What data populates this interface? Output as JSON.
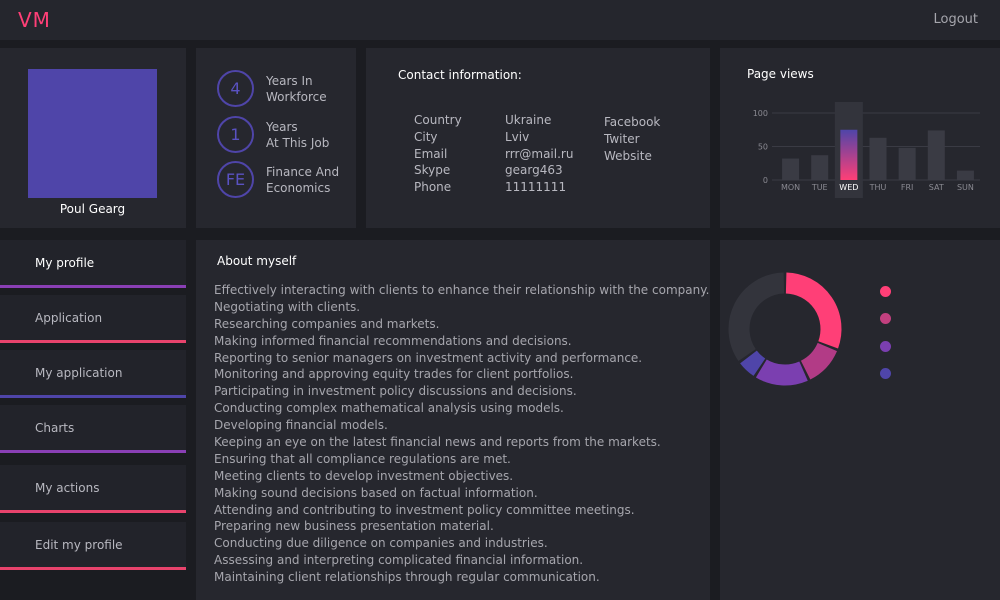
{
  "app": {
    "logo": "VM",
    "logout_label": "Logout"
  },
  "profile": {
    "name": "Poul Gearg"
  },
  "stats": [
    {
      "value": "4",
      "label_line1": "Years In",
      "label_line2": "Workforce"
    },
    {
      "value": "1",
      "label_line1": "Years",
      "label_line2": "At This Job"
    },
    {
      "value": "FE",
      "label_line1": "Finance And",
      "label_line2": "Economics"
    }
  ],
  "contact": {
    "title": "Contact information:",
    "rows": [
      {
        "key": "Country",
        "value": "Ukraine"
      },
      {
        "key": "City",
        "value": "Lviv"
      },
      {
        "key": "Email",
        "value": "rrr@mail.ru"
      },
      {
        "key": "Skype",
        "value": "gearg463"
      },
      {
        "key": "Phone",
        "value": "11111111"
      }
    ],
    "social": [
      "Facebook",
      "Twiter",
      "Website"
    ]
  },
  "page_views": {
    "title": "Page views",
    "y_ticks": [
      "100",
      "50",
      "0"
    ]
  },
  "chart_data": [
    {
      "type": "bar",
      "title": "Page views",
      "categories": [
        "MON",
        "TUE",
        "WED",
        "THU",
        "FRI",
        "SAT",
        "SUN"
      ],
      "values": [
        32,
        37,
        75,
        63,
        48,
        74,
        14
      ],
      "highlighted": "WED",
      "ylim": [
        0,
        100
      ],
      "y_ticks": [
        0,
        50,
        100
      ],
      "grid": true
    },
    {
      "type": "pie",
      "style": "donut",
      "values": [
        31,
        12,
        16,
        6,
        35
      ],
      "colors": [
        "#ff3f77",
        "#b23b86",
        "#7b3fb0",
        "#4f45a9",
        "#33343c"
      ]
    }
  ],
  "menu": {
    "items": [
      {
        "label": "My profile",
        "color": "#8a3fb5"
      },
      {
        "label": "Application",
        "color": "#e8436c"
      },
      {
        "label": "My application",
        "color": "#4f45a9"
      },
      {
        "label": "Charts",
        "color": "#8a3fb5"
      },
      {
        "label": "My actions",
        "color": "#e8436c"
      },
      {
        "label": "Edit my profile",
        "color": "#e8436c"
      }
    ]
  },
  "about": {
    "title": "About myself",
    "lines": [
      "Effectively interacting with clients to enhance their relationship with the company.",
      "Negotiating with clients.",
      "Researching companies and markets.",
      "Making informed financial recommendations and decisions.",
      "Reporting to senior managers on investment activity and performance.",
      "Monitoring and approving equity trades for client portfolios.",
      "Participating in investment policy discussions and decisions.",
      "Conducting complex mathematical analysis using models.",
      "Developing financial models.",
      "Keeping an eye on the latest financial news and reports from the markets.",
      "Ensuring that all compliance regulations are met.",
      "Meeting clients to develop investment objectives.",
      "Making sound decisions based on factual information.",
      "Attending and contributing to investment policy committee meetings.",
      "Preparing new business presentation material.",
      "Conducting due diligence on companies and industries.",
      "Assessing and interpreting complicated financial information.",
      "Maintaining client relationships through regular communication."
    ]
  },
  "colors": {
    "accent_pink": "#ff3f77",
    "accent_purple": "#4f45a9",
    "panel": "#26272e",
    "background": "#1b1c21"
  },
  "legend_colors": [
    "#ff3f77",
    "#c2407f",
    "#7b3fb0",
    "#4f45a9"
  ]
}
